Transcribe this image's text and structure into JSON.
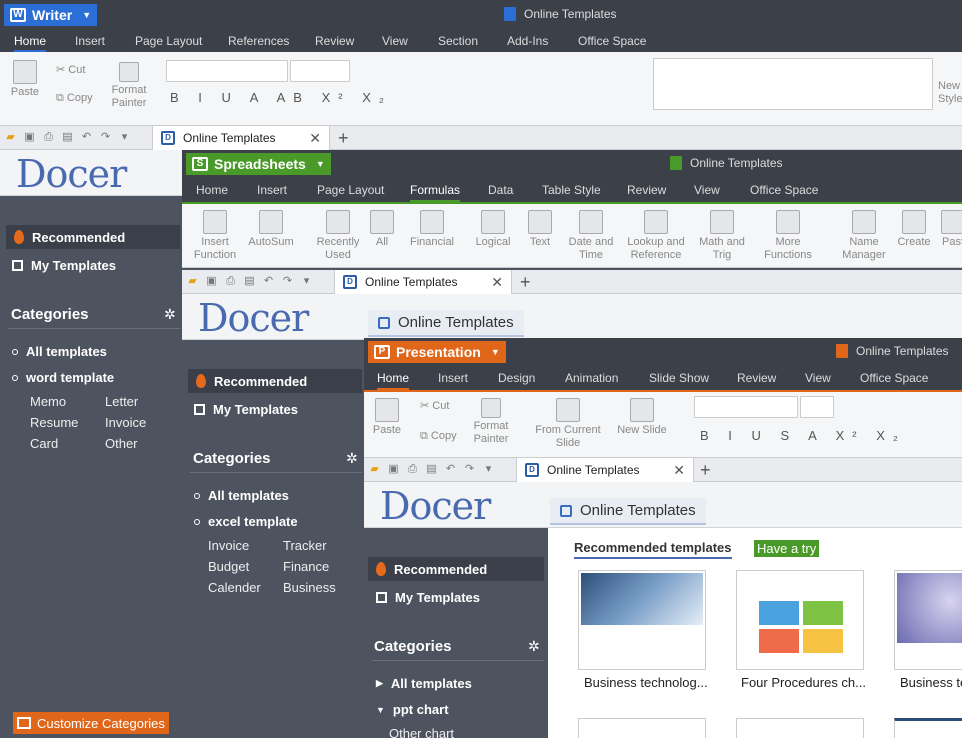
{
  "writer": {
    "app": "Writer",
    "title": "Online Templates",
    "menu": [
      "Home",
      "Insert",
      "Page Layout",
      "References",
      "Review",
      "View",
      "Section",
      "Add-Ins",
      "Office Space"
    ],
    "ribbon": {
      "paste": "Paste",
      "cut": "Cut",
      "copy": "Copy",
      "format_painter": "Format Painter",
      "new_style": "New Style"
    },
    "tab": "Online Templates",
    "sidebar": {
      "recommended": "Recommended",
      "my_templates": "My Templates",
      "categories": "Categories",
      "all": "All templates",
      "group": "word template",
      "subs": [
        "Memo",
        "Letter",
        "Resume",
        "Invoice",
        "Card",
        "Other"
      ],
      "customize": "Customize Categories"
    }
  },
  "spreadsheets": {
    "app": "Spreadsheets",
    "title": "Online Templates",
    "menu": [
      "Home",
      "Insert",
      "Page Layout",
      "Formulas",
      "Data",
      "Table Style",
      "Review",
      "View",
      "Office Space"
    ],
    "ribbon": [
      "Insert Function",
      "AutoSum",
      "Recently Used",
      "All",
      "Financial",
      "Logical",
      "Text",
      "Date and Time",
      "Lookup and Reference",
      "Math and Trig",
      "More Functions",
      "Name Manager",
      "Create",
      "Past"
    ],
    "tab": "Online Templates",
    "content_tab": "Online Templates",
    "sidebar": {
      "recommended": "Recommended",
      "my_templates": "My Templates",
      "categories": "Categories",
      "all": "All templates",
      "group": "excel template",
      "subs": [
        "Invoice",
        "Tracker",
        "Budget",
        "Finance",
        "Calender",
        "Business"
      ]
    }
  },
  "presentation": {
    "app": "Presentation",
    "title": "Online Templates",
    "menu": [
      "Home",
      "Insert",
      "Design",
      "Animation",
      "Slide Show",
      "Review",
      "View",
      "Office Space"
    ],
    "ribbon": {
      "paste": "Paste",
      "cut": "Cut",
      "copy": "Copy",
      "format_painter": "Format Painter",
      "from_current": "From Current Slide",
      "new_slide": "New Slide"
    },
    "tab": "Online Templates",
    "content_tab": "Online Templates",
    "sidebar": {
      "recommended": "Recommended",
      "my_templates": "My Templates",
      "categories": "Categories",
      "all": "All templates",
      "group": "ppt chart",
      "sub": "Other chart"
    },
    "recommended_heading": "Recommended templates",
    "have_a_try": "Have a try",
    "templates": [
      "Business technolog...",
      "Four Procedures ch...",
      "Business te"
    ]
  },
  "colors": {
    "writer": "#2b6fd6",
    "spreadsheets": "#4a9a2a",
    "presentation": "#e0661a"
  },
  "docer_logo": "Docer"
}
